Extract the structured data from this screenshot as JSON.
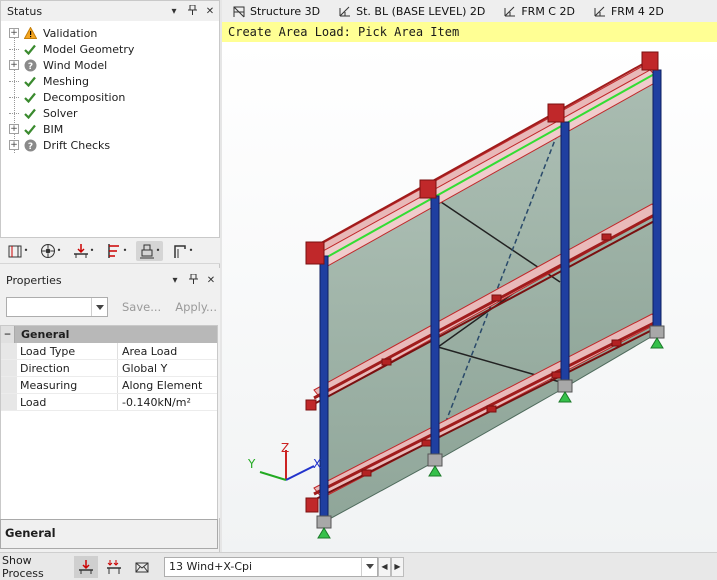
{
  "status_panel": {
    "title": "Status",
    "items": [
      {
        "label": "Validation",
        "icon": "warning-icon",
        "expandable": true
      },
      {
        "label": "Model Geometry",
        "icon": "check-icon",
        "expandable": false
      },
      {
        "label": "Wind Model",
        "icon": "question-icon",
        "expandable": true
      },
      {
        "label": "Meshing",
        "icon": "check-icon",
        "expandable": false
      },
      {
        "label": "Decomposition",
        "icon": "check-icon",
        "expandable": false
      },
      {
        "label": "Solver",
        "icon": "check-icon",
        "expandable": false
      },
      {
        "label": "BIM",
        "icon": "check-icon",
        "expandable": true
      },
      {
        "label": "Drift Checks",
        "icon": "question-icon",
        "expandable": true
      }
    ],
    "buttons": {
      "pin": "҂",
      "close": "✕",
      "dropdown": "▾"
    }
  },
  "toolbar_icons": [
    "model-view-icon",
    "wind-icon",
    "load-icon",
    "level-icon",
    "support-icon",
    "member-icon"
  ],
  "properties_panel": {
    "title": "Properties",
    "save_label": "Save...",
    "apply_label": "Apply...",
    "category": "General",
    "rows": [
      {
        "key": "Load Type",
        "value": "Area Load"
      },
      {
        "key": "Direction",
        "value": "Global Y"
      },
      {
        "key": "Measuring",
        "value": "Along Element"
      },
      {
        "key": "Load",
        "value": "-0.140kN/m²"
      }
    ],
    "description_title": "General"
  },
  "doc_tabs": [
    {
      "label": "Structure 3D"
    },
    {
      "label": "St. BL (BASE LEVEL) 2D"
    },
    {
      "label": "FRM C 2D"
    },
    {
      "label": "FRM 4 2D"
    }
  ],
  "hint": "Create Area Load: Pick Area Item",
  "axes": {
    "x": "X",
    "y": "Y",
    "z": "Z"
  },
  "bottom_bar": {
    "show_process_label": "Show Process",
    "load_case": "13 Wind+X-Cpi"
  },
  "colors": {
    "beam_red": "#c0282a",
    "column_blue": "#1f3fa0",
    "panel_fill": "#8ea597",
    "highlight_green": "#33dd33",
    "support_green": "#35c04a",
    "hint_bg": "#ffff94"
  }
}
